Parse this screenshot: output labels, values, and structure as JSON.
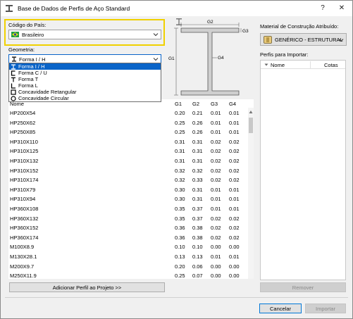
{
  "window": {
    "title": "Base de Dados de Perfis de Aço Standard",
    "help_label": "?",
    "close_label": "✕"
  },
  "country": {
    "label": "Código do País:",
    "value": "Brasileiro"
  },
  "geometry": {
    "label": "Geometria:",
    "value": "Forma I / H",
    "options": [
      "Forma I / H",
      "Forma C / U",
      "Forma T",
      "Forma L",
      "Concavidade Retangular",
      "Concavidade Circular"
    ]
  },
  "diagram": {
    "g1": "G1",
    "g2": "G2",
    "g3": "G3",
    "g4": "G4"
  },
  "table": {
    "headers": [
      "Nome",
      "G1",
      "G2",
      "G3",
      "G4"
    ],
    "rows": [
      [
        "HP200X54",
        "0.20",
        "0.21",
        "0.01",
        "0.01"
      ],
      [
        "HP250X62",
        "0.25",
        "0.26",
        "0.01",
        "0.01"
      ],
      [
        "HP250X85",
        "0.25",
        "0.26",
        "0.01",
        "0.01"
      ],
      [
        "HP310X110",
        "0.31",
        "0.31",
        "0.02",
        "0.02"
      ],
      [
        "HP310X125",
        "0.31",
        "0.31",
        "0.02",
        "0.02"
      ],
      [
        "HP310X132",
        "0.31",
        "0.31",
        "0.02",
        "0.02"
      ],
      [
        "HP310X152",
        "0.32",
        "0.32",
        "0.02",
        "0.02"
      ],
      [
        "HP310X174",
        "0.32",
        "0.33",
        "0.02",
        "0.02"
      ],
      [
        "HP310X79",
        "0.30",
        "0.31",
        "0.01",
        "0.01"
      ],
      [
        "HP310X94",
        "0.30",
        "0.31",
        "0.01",
        "0.01"
      ],
      [
        "HP360X108",
        "0.35",
        "0.37",
        "0.01",
        "0.01"
      ],
      [
        "HP360X132",
        "0.35",
        "0.37",
        "0.02",
        "0.02"
      ],
      [
        "HP360X152",
        "0.36",
        "0.38",
        "0.02",
        "0.02"
      ],
      [
        "HP360X174",
        "0.36",
        "0.38",
        "0.02",
        "0.02"
      ],
      [
        "M100X8.9",
        "0.10",
        "0.10",
        "0.00",
        "0.00"
      ],
      [
        "M130X28.1",
        "0.13",
        "0.13",
        "0.01",
        "0.01"
      ],
      [
        "M200X9.7",
        "0.20",
        "0.06",
        "0.00",
        "0.00"
      ],
      [
        "M250X11.9",
        "0.25",
        "0.07",
        "0.00",
        "0.00"
      ]
    ]
  },
  "add_button": "Adicionar Perfil ao Projeto >>",
  "material": {
    "label": "Material de Construção Atribuído:",
    "value": "GENÉRICO - ESTRUTURAL"
  },
  "import_list": {
    "label": "Perfis para Importar:",
    "col_name": "Nome",
    "col_cotas": "Cotas"
  },
  "remove_button": "Remover",
  "cancel_button": "Cancelar",
  "import_button": "Importar"
}
